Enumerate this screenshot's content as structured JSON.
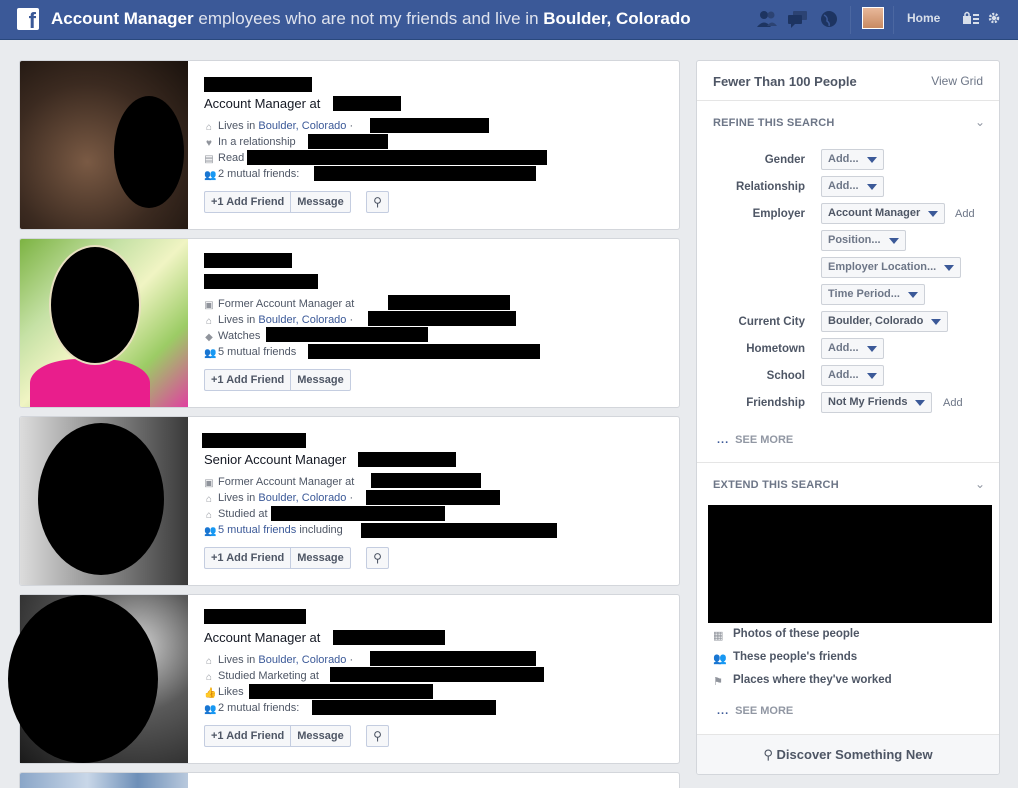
{
  "topbar": {
    "query_bold_1": "Account Manager",
    "query_light": " employees who are not my friends and live in ",
    "query_bold_2": "Boulder, Colorado",
    "home_label": "Home"
  },
  "results": [
    {
      "title_prefix": "Account Manager at ",
      "details": [
        {
          "prefix": "Lives in ",
          "link": "Boulder, Colorado",
          "suffix": " ·"
        },
        {
          "prefix": "In a relationship",
          "link": "",
          "suffix": ""
        },
        {
          "prefix": "Read",
          "link": "",
          "suffix": ""
        },
        {
          "prefix": "2 mutual friends:",
          "link": "",
          "suffix": ""
        }
      ]
    },
    {
      "title_prefix": "",
      "details": [
        {
          "prefix": "Former Account Manager at",
          "link": "",
          "suffix": ""
        },
        {
          "prefix": "Lives in ",
          "link": "Boulder, Colorado",
          "suffix": " ·"
        },
        {
          "prefix": "Watches",
          "link": "",
          "suffix": ""
        },
        {
          "prefix": "5 mutual friends",
          "link": "",
          "suffix": ""
        }
      ]
    },
    {
      "title_prefix": "Senior Account Manager",
      "details": [
        {
          "prefix": "Former Account Manager at",
          "link": "",
          "suffix": ""
        },
        {
          "prefix": "Lives in ",
          "link": "Boulder, Colorado",
          "suffix": " ·"
        },
        {
          "prefix": "Studied at",
          "link": "",
          "suffix": ""
        },
        {
          "prefix": "",
          "link": "5 mutual friends",
          "suffix": " including"
        }
      ]
    },
    {
      "title_prefix": "Account Manager at ",
      "details": [
        {
          "prefix": "Lives in ",
          "link": "Boulder, Colorado",
          "suffix": " ·"
        },
        {
          "prefix": "Studied Marketing at",
          "link": "",
          "suffix": ""
        },
        {
          "prefix": "Likes",
          "link": "",
          "suffix": ""
        },
        {
          "prefix": "2 mutual friends:",
          "link": "",
          "suffix": ""
        }
      ]
    }
  ],
  "card_buttons": {
    "add_friend": "Add Friend",
    "message": "Message"
  },
  "sidebar": {
    "heading": "Fewer Than 100 People",
    "view_grid": "View Grid",
    "refine_title": "REFINE THIS SEARCH",
    "filters": {
      "gender_label": "Gender",
      "gender_value": "Add...",
      "relationship_label": "Relationship",
      "relationship_value": "Add...",
      "employer_label": "Employer",
      "employer_value": "Account Manager",
      "employer_add": "Add",
      "position_value": "Position...",
      "employer_location_value": "Employer Location...",
      "time_period_value": "Time Period...",
      "current_city_label": "Current City",
      "current_city_value": "Boulder, Colorado",
      "hometown_label": "Hometown",
      "hometown_value": "Add...",
      "school_label": "School",
      "school_value": "Add...",
      "friendship_label": "Friendship",
      "friendship_value": "Not My Friends",
      "friendship_add": "Add"
    },
    "see_more": "SEE MORE",
    "extend_title": "EXTEND THIS SEARCH",
    "extend_items": [
      "Photos of these people",
      "These people's friends",
      "Places where they've worked"
    ],
    "see_more_2": "SEE MORE",
    "discover": "Discover Something New"
  }
}
